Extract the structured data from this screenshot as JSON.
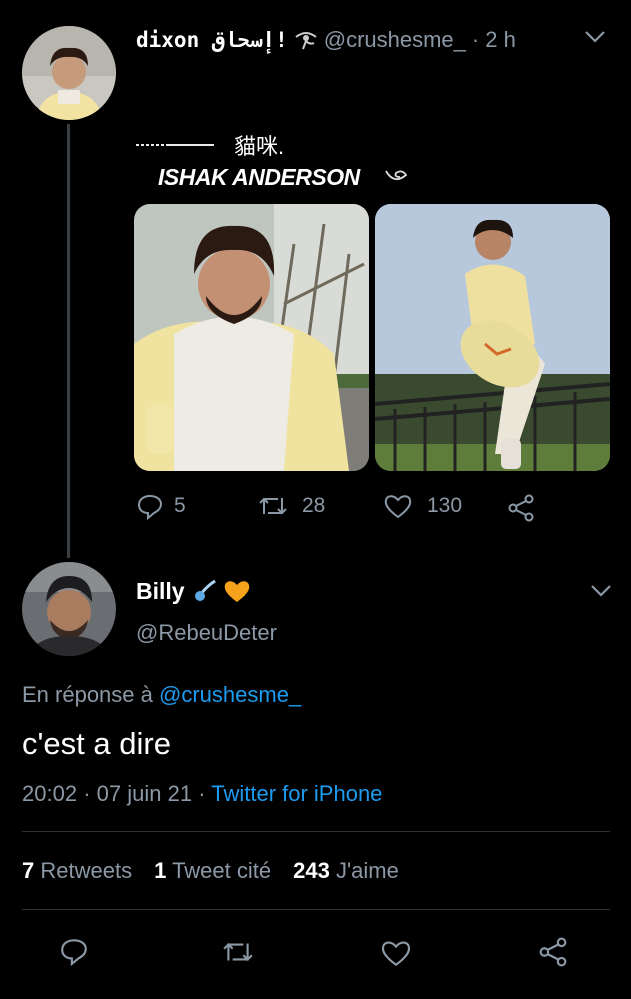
{
  "tweet1": {
    "display_name": "dixon إسحاق!",
    "handle": "@crushesme_",
    "time": "2 h",
    "line1": "貓咪.",
    "line2": "ISHAK ANDERSON",
    "stats": {
      "replies": "5",
      "retweets": "28",
      "likes": "130"
    }
  },
  "reply": {
    "display_name": "Billy",
    "handle": "@RebeuDeter",
    "in_reply_prefix": "En réponse à",
    "in_reply_handle": "@crushesme_",
    "text": "c'est a dire",
    "time": "20:02",
    "date": "07 juin 21",
    "source": "Twitter for iPhone",
    "retweets_count": "7",
    "retweets_label": "Retweets",
    "quotes_count": "1",
    "quotes_label": "Tweet cité",
    "likes_count": "243",
    "likes_label": "J'aime"
  },
  "icons": {
    "name_badge": "eye-of-horus-icon",
    "emoji1": "comet-icon",
    "emoji2": "orange-heart-icon"
  },
  "colors": {
    "link": "#1d9bf0",
    "muted": "#8b98a5",
    "heart": "#f7a21b"
  }
}
